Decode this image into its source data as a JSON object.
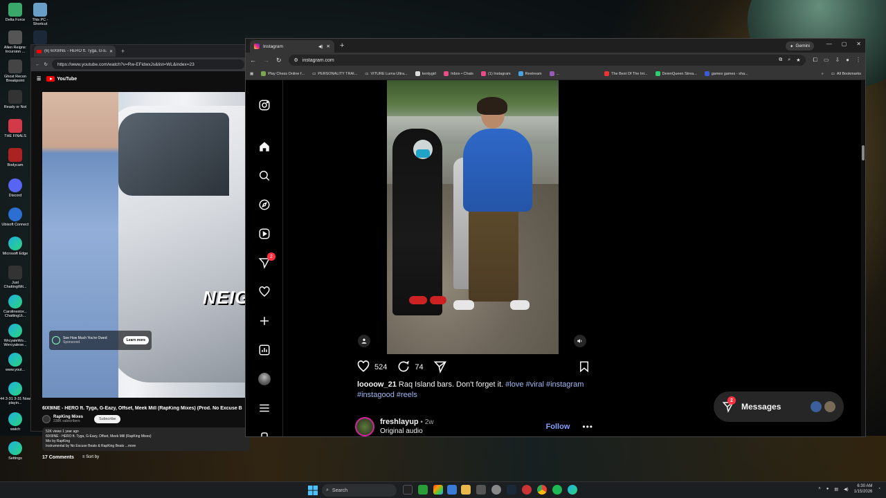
{
  "desktop": {
    "icons_col1": [
      "Delta Force",
      "Allen Reigns: Incursion ...",
      "Ghost Recon Breakpoint",
      "Ready or Not",
      "THE FINALS",
      "Bodycam",
      "Discord",
      "Ubisoft Connect",
      "Microsoft Edge",
      "Just ChattingWit...",
      "Carolinestor... ChattingUi...",
      "WrcyaleWo... Wercyalese...",
      "www.yout...",
      "44 3-31 3-31 Now playin...",
      "watch",
      "Settings"
    ],
    "icons_col2": [
      "This PC - Shortcut"
    ]
  },
  "youtube_window": {
    "tab_title": "(6) 6IX9INE - HERO ft. Tyga, G-Eaz...",
    "url": "https://www.youtube.com/watch?v=Rw-EFidwxJs&list=WL&index=23",
    "logo": "YouTube",
    "overlay_text": "NEIG",
    "ad_text": "See How Much You're Owed",
    "ad_sub": "Sponsored",
    "learn_more": "Learn more",
    "video_title": "6IX9INE - HERO ft. Tyga, G-Eazy, Offset, Meek Mill (RapKing Mixes) (Prod. No Excuse B",
    "channel": "RapKing Mixes",
    "subscribers": "238K subscribers",
    "subscribe": "Subscribe",
    "meta": "52K views  1 year ago",
    "desc_lines": [
      "6IX9INE - HERO ft. Tyga, G-Eazy, Offset, Meek Mill (RapKing Mixes)",
      "Mix by RapKing",
      "Instrumental by No Excuse Beats & RapKing Beats  ...more"
    ],
    "comments": "17 Comments",
    "sort_by": "Sort by"
  },
  "chrome": {
    "tab_title": "Instagram",
    "gemini": "Gemini",
    "url": "instagram.com",
    "bookmarks": [
      "Play Chess Online f...",
      "PERSONALITY TRAI...",
      "VITURE Luma Ultra...",
      "kentygirl",
      "Inbox • Chats",
      "(1) Instagram",
      "Restream",
      "...",
      "The Best Of The Int...",
      "DeienQueen Strea...",
      "games games - sha..."
    ],
    "all_bookmarks": "All Bookmarks"
  },
  "instagram": {
    "notification_badge": "2",
    "likes": "524",
    "comments": "74",
    "caption_user": "loooow_21",
    "caption_text": " Raq Island bars. Don't forget it. ",
    "hashtags_line1": "#love #viral #instagram",
    "hashtags_line2": "#instagood #reels",
    "next_user": "freshlayup",
    "next_age": " • 2w",
    "next_audio": "Original audio",
    "follow": "Follow",
    "more": "•••",
    "messages": "Messages",
    "messages_badge": "2"
  },
  "taskbar": {
    "search": "Search",
    "time": "6:30 AM",
    "date": "1/15/2026"
  },
  "colors": {
    "instagram_link": "#a1b8f5",
    "follow_blue": "#85a1ff",
    "badge_red": "#ff3040"
  }
}
